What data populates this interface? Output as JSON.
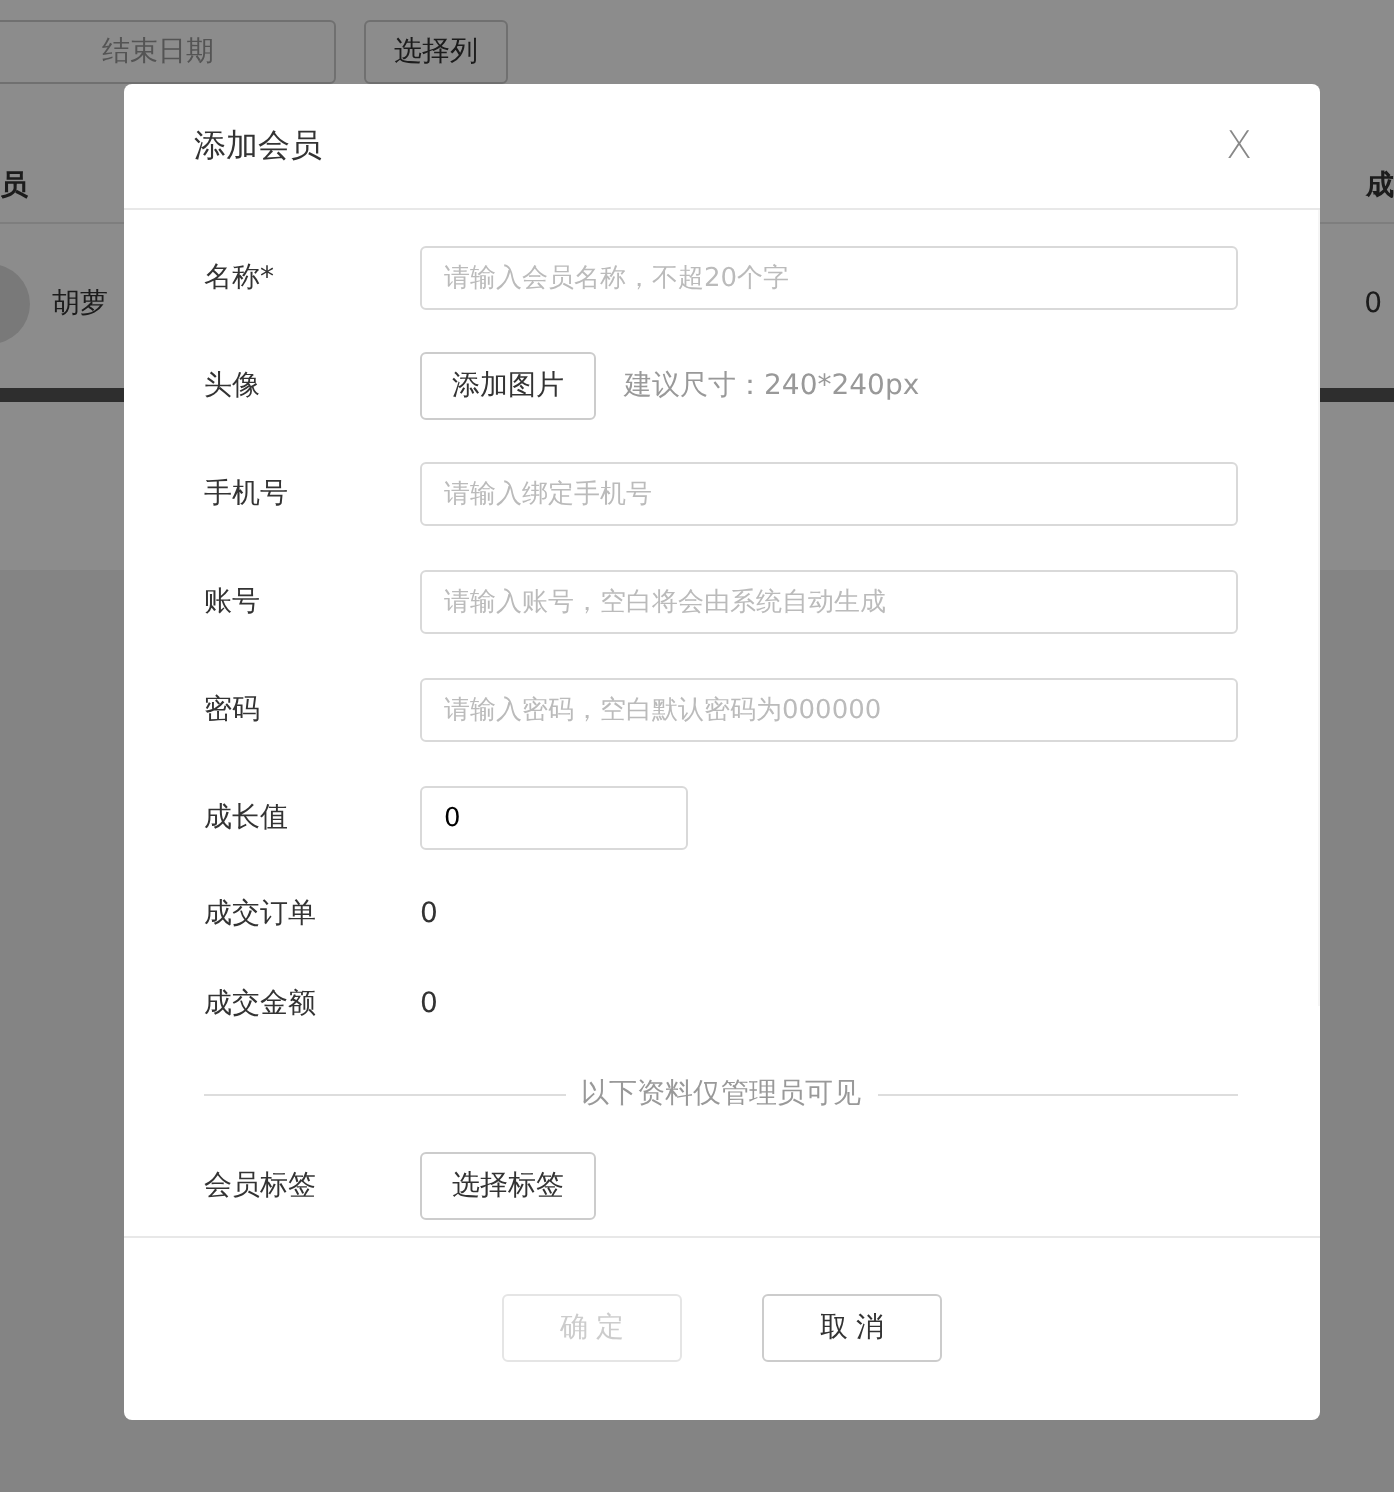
{
  "page": {
    "date_field": {
      "placeholder": "结束日期"
    },
    "column_button": "选择列",
    "table": {
      "columns": [
        "员",
        "成"
      ],
      "rows": [
        {
          "cells": [
            "胡萝",
            "0"
          ]
        }
      ]
    }
  },
  "dialog": {
    "title": "添加会员",
    "close": "X",
    "fields": [
      {
        "kind": "input",
        "label": "名称*",
        "placeholder": "请输入会员名称，不超20个字",
        "wide": true
      },
      {
        "kind": "upload",
        "label": "头像",
        "button": "添加图片",
        "hint": "建议尺寸：240*240px"
      },
      {
        "kind": "input",
        "label": "手机号",
        "placeholder": "请输入绑定手机号",
        "wide": true
      },
      {
        "kind": "input",
        "label": "账号",
        "placeholder": "请输入账号，空白将会由系统自动生成",
        "wide": true
      },
      {
        "kind": "input",
        "label": "密码",
        "placeholder": "请输入密码，空白默认密码为000000",
        "wide": true
      },
      {
        "kind": "input",
        "label": "成长值",
        "value": "0",
        "wide": false
      },
      {
        "kind": "value",
        "label": "成交订单",
        "value": "0"
      },
      {
        "kind": "value",
        "label": "成交金额",
        "value": "0"
      },
      {
        "kind": "divider",
        "label": "以下资料仅管理员可见"
      },
      {
        "kind": "upload",
        "label": "会员标签",
        "button": "选择标签"
      }
    ],
    "buttons": [
      {
        "label": "确 定",
        "disabled": true
      },
      {
        "label": "取 消",
        "disabled": false
      }
    ]
  }
}
